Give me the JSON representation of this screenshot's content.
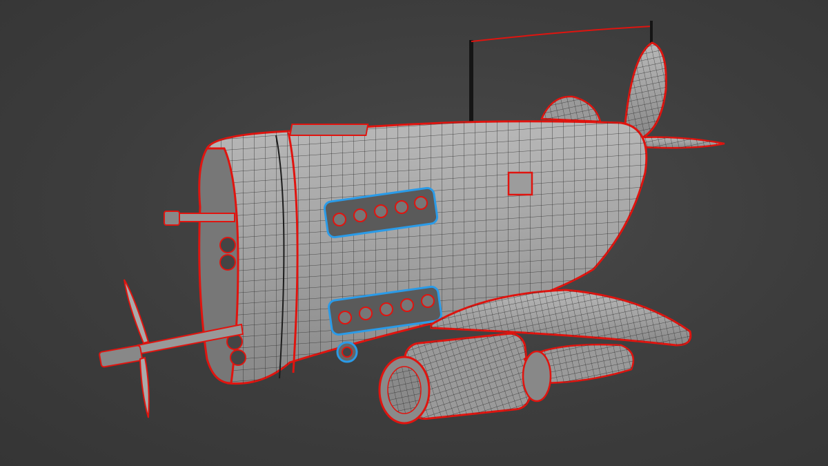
{
  "scene": {
    "colors": {
      "background": "#3d3d3d",
      "mesh_surface": "#a9a9a9",
      "wire": "#1e1e1e",
      "seam_edges": "#e0140f",
      "selected_edges": "#2a9be8"
    }
  }
}
